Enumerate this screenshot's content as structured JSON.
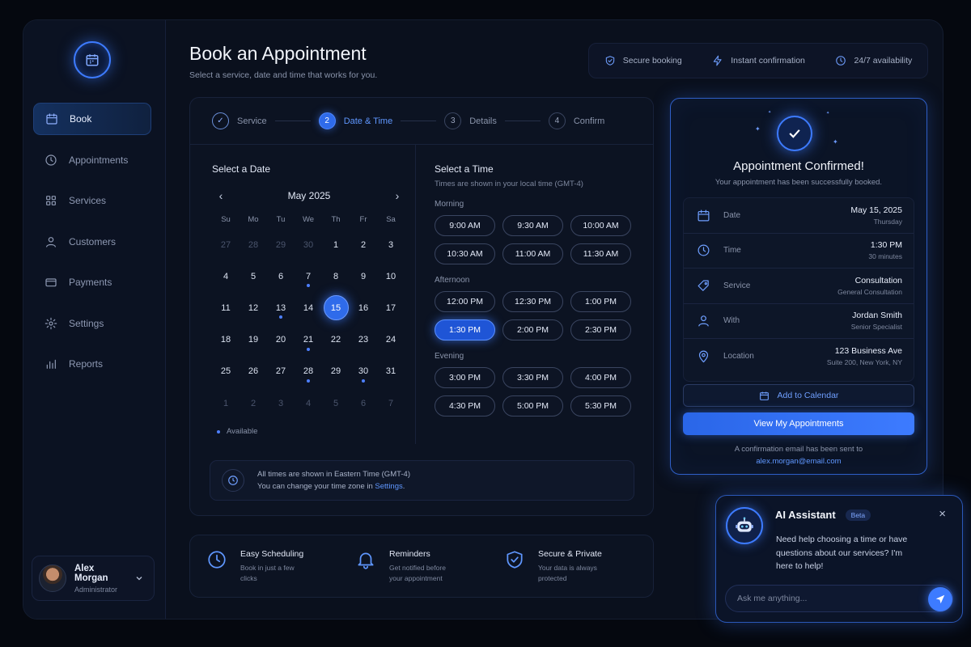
{
  "sidebar": {
    "items": [
      {
        "label": "Book",
        "icon": "calendar-icon",
        "active": true
      },
      {
        "label": "Appointments",
        "icon": "clock-icon"
      },
      {
        "label": "Services",
        "icon": "grid-icon"
      },
      {
        "label": "Customers",
        "icon": "user-icon"
      },
      {
        "label": "Payments",
        "icon": "card-icon"
      },
      {
        "label": "Settings",
        "icon": "gear-icon"
      },
      {
        "label": "Reports",
        "icon": "bar-chart-icon"
      }
    ],
    "user": {
      "name": "Alex Morgan",
      "role": "Administrator"
    }
  },
  "header": {
    "title": "Book an Appointment",
    "subtitle": "Select a service, date and time that works for you.",
    "badges": [
      {
        "label": "Secure booking",
        "icon": "shield-check-icon"
      },
      {
        "label": "Instant confirmation",
        "icon": "lightning-icon"
      },
      {
        "label": "24/7 availability",
        "icon": "clock-icon"
      }
    ]
  },
  "steps": [
    {
      "num": "✓",
      "label": "Service",
      "state": "done"
    },
    {
      "num": "2",
      "label": "Date & Time",
      "state": "current"
    },
    {
      "num": "3",
      "label": "Details",
      "state": "upcoming"
    },
    {
      "num": "4",
      "label": "Confirm",
      "state": "upcoming"
    }
  ],
  "calendar": {
    "title": "Select a Date",
    "month": "May 2025",
    "weekdays": [
      "Su",
      "Mo",
      "Tu",
      "We",
      "Th",
      "Fr",
      "Sa"
    ],
    "days": [
      {
        "d": "27",
        "muted": true
      },
      {
        "d": "28",
        "muted": true
      },
      {
        "d": "29",
        "muted": true
      },
      {
        "d": "30",
        "muted": true
      },
      {
        "d": "1"
      },
      {
        "d": "2"
      },
      {
        "d": "3"
      },
      {
        "d": "4"
      },
      {
        "d": "5"
      },
      {
        "d": "6"
      },
      {
        "d": "7",
        "available": true
      },
      {
        "d": "8"
      },
      {
        "d": "9"
      },
      {
        "d": "10"
      },
      {
        "d": "11"
      },
      {
        "d": "12"
      },
      {
        "d": "13",
        "available": true
      },
      {
        "d": "14"
      },
      {
        "d": "15",
        "selected": true
      },
      {
        "d": "16"
      },
      {
        "d": "17"
      },
      {
        "d": "18"
      },
      {
        "d": "19"
      },
      {
        "d": "20"
      },
      {
        "d": "21",
        "available": true
      },
      {
        "d": "22"
      },
      {
        "d": "23"
      },
      {
        "d": "24"
      },
      {
        "d": "25"
      },
      {
        "d": "26"
      },
      {
        "d": "27"
      },
      {
        "d": "28",
        "available": true
      },
      {
        "d": "29"
      },
      {
        "d": "30",
        "available": true
      },
      {
        "d": "31"
      },
      {
        "d": "1",
        "muted": true
      },
      {
        "d": "2",
        "muted": true
      },
      {
        "d": "3",
        "muted": true
      },
      {
        "d": "4",
        "muted": true
      },
      {
        "d": "5",
        "muted": true
      },
      {
        "d": "6",
        "muted": true
      },
      {
        "d": "7",
        "muted": true
      }
    ],
    "legend": "Available"
  },
  "times": {
    "title": "Select a Time",
    "timezone_note": "Times are shown in your local time (GMT-4)",
    "groups": [
      {
        "label": "Morning",
        "slots": [
          "9:00 AM",
          "9:30 AM",
          "10:00 AM",
          "10:30 AM",
          "11:00 AM",
          "11:30 AM"
        ]
      },
      {
        "label": "Afternoon",
        "slots": [
          "12:00 PM",
          "12:30 PM",
          "1:00 PM",
          "1:30 PM",
          "2:00 PM",
          "2:30 PM"
        ]
      },
      {
        "label": "Evening",
        "slots": [
          "3:00 PM",
          "3:30 PM",
          "4:00 PM",
          "4:30 PM",
          "5:00 PM",
          "5:30 PM"
        ]
      }
    ],
    "selected": "1:30 PM"
  },
  "tz_note": {
    "line1": "All times are shown in Eastern Time (GMT-4)",
    "line2_prefix": "You can change your time zone in",
    "link": "Settings",
    "suffix": "."
  },
  "features": [
    {
      "title": "Easy Scheduling",
      "desc": "Book in just a few clicks",
      "icon": "clock-icon"
    },
    {
      "title": "Reminders",
      "desc": "Get notified before your appointment",
      "icon": "bell-icon"
    },
    {
      "title": "Secure & Private",
      "desc": "Your data is always protected",
      "icon": "shield-check-icon"
    }
  ],
  "confirmation": {
    "title": "Appointment Confirmed!",
    "subtitle": "Your appointment has been successfully booked.",
    "rows": [
      {
        "label": "Date",
        "value": "May 15, 2025",
        "sub": "Thursday",
        "icon": "calendar-icon"
      },
      {
        "label": "Time",
        "value": "1:30 PM",
        "sub": "30 minutes",
        "icon": "clock-icon"
      },
      {
        "label": "Service",
        "value": "Consultation",
        "sub": "General Consultation",
        "icon": "tag-icon"
      },
      {
        "label": "With",
        "value": "Jordan Smith",
        "sub": "Senior Specialist",
        "icon": "user-icon"
      },
      {
        "label": "Location",
        "value": "123 Business Ave",
        "sub": "Suite 200, New York, NY",
        "icon": "location-pin-icon"
      }
    ],
    "add_calendar": "Add to Calendar",
    "view_button": "View My Appointments",
    "email_note": "A confirmation email has been sent to",
    "email": "alex.morgan@email.com"
  },
  "assistant": {
    "title": "AI Assistant",
    "badge": "Beta",
    "message": "Need help choosing a time or have questions about our services? I'm here to help!",
    "input_placeholder": "Ask me anything...",
    "close": "×"
  },
  "colors": {
    "accent": "#3d7bff",
    "background": "#0a101d",
    "panel": "#0c1322"
  }
}
